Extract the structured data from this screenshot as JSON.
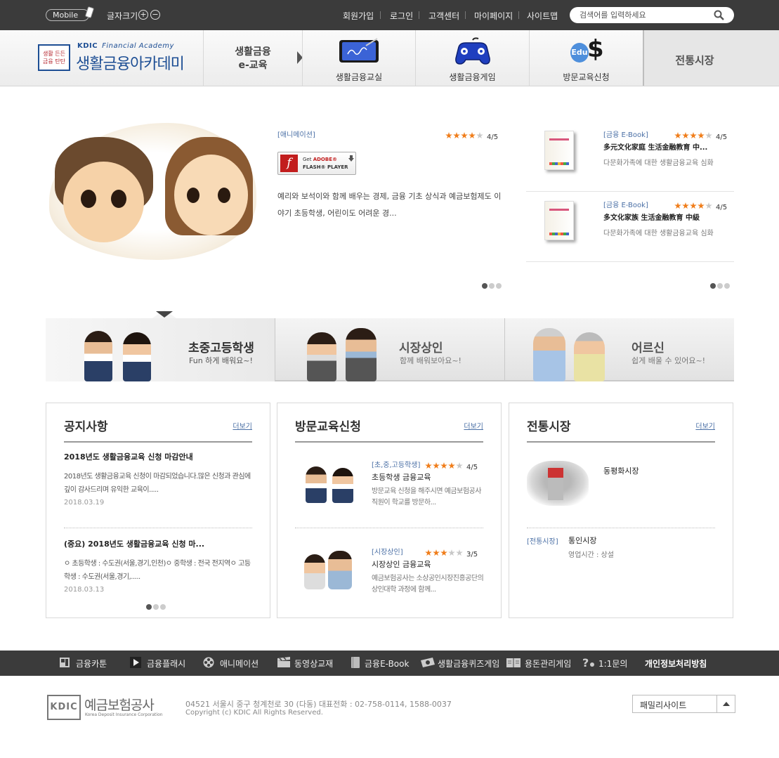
{
  "topbar": {
    "mobile_label": "Mobile",
    "font_size_label": "글자크기",
    "font_plus": "+",
    "font_minus": "−",
    "links": [
      "회원가입",
      "로그인",
      "고객센터",
      "마이페이지",
      "사이트맵"
    ],
    "search_placeholder": "검색어를 입력하세요"
  },
  "header": {
    "logo_seal_line1": "생활 든든",
    "logo_seal_line2": "금융 탄탄",
    "logo_kdic": "KDIC",
    "logo_academy": "Financial Academy",
    "logo_title": "생활금융아카데미",
    "nav_title_line1": "생활금융",
    "nav_title_line2": "e-교육",
    "nav_items": [
      "생활금융교실",
      "생활금융게임",
      "방문교육신청"
    ],
    "edu_icon_text": "Edu",
    "nav_last": "전통시장"
  },
  "featured": {
    "category": "[애니메이션]",
    "rating_value": 4,
    "rating_text": "4/5",
    "flash_line1_prefix": "Get ",
    "flash_line1_brand": "ADOBE®",
    "flash_line2": "FLASH® PLAYER",
    "description": "예리와 보석이와 함께 배우는 경제, 금융 기초 상식과 예금보험제도 이야기 초등학생, 어린이도 어려운 경..."
  },
  "ebooks": [
    {
      "category": "[금융 E-Book]",
      "rating_value": 4,
      "rating_text": "4/5",
      "title": "多元文化家庭 生活金融教育 中...",
      "desc": "다문화가족에 대한 생활금융교육 심화"
    },
    {
      "category": "[금융 E-Book]",
      "rating_value": 4,
      "rating_text": "4/5",
      "title": "多文化家族 生活金融教育 中級",
      "desc": "다문화가족에 대한 생활금융교육 심화"
    }
  ],
  "targets": [
    {
      "title": "초중고등학생",
      "sub": "Fun 하게 배워요~!"
    },
    {
      "title": "시장상인",
      "sub": "함께 배워보아요~!"
    },
    {
      "title": "어르신",
      "sub": "쉽게 배울 수 있어요~!"
    }
  ],
  "notice": {
    "title": "공지사항",
    "more": "더보기",
    "items": [
      {
        "title": "2018년도 생활금융교육 신청 마감안내",
        "body": "2018년도 생활금융교육 신청이 마감되었습니다.많은 신청과 관심에 깊이 감사드리며 유익한 교육이.....",
        "date": "2018.03.19"
      },
      {
        "title": "(중요) 2018년도 생활금융교육 신청 마...",
        "body": "ㅇ 초등학생 : 수도권(서울,경기,인천)ㅇ 중학생 : 전국 전지역ㅇ 고등학생 : 수도권(서울,경기,.....",
        "date": "2018.03.13"
      }
    ]
  },
  "visit": {
    "title": "방문교육신청",
    "more": "더보기",
    "items": [
      {
        "category": "[초,중,고등학생]",
        "rating_value": 4,
        "rating_text": "4/5",
        "title": "초등학생 금융교육",
        "body": "방문교육 신청을 해주시면 예금보험공사 직원이 학교를 방문하..."
      },
      {
        "category": "[시장상인]",
        "rating_value": 3,
        "rating_text": "3/5",
        "title": "시장상인 금융교육",
        "body": "예금보험공사는 소상공인시장진흥공단의 상인대학 과정에 함께..."
      }
    ]
  },
  "market": {
    "title": "전통시장",
    "more": "더보기",
    "featured_name": "동평화시장",
    "item_category": "[전통시장]",
    "item_name": "통인시장",
    "item_hours": "영업시간 : 상설"
  },
  "footnav": [
    "금융카툰",
    "금융플래시",
    "애니메이션",
    "동영상교재",
    "금융E-Book",
    "생활금융퀴즈게임",
    "용돈관리게임",
    "1:1문의",
    "개인정보처리방침"
  ],
  "footer": {
    "logo_text": "KDIC",
    "org_name": "예금보험공사",
    "org_eng": "Korea Deposit Insurance Corporation",
    "address": "04521   서울시 중구 청계천로 30 (다동)   대표전화 : 02-758-0114, 1588-0037",
    "copyright": "Copyright (c) KDIC All Rights Reserved.",
    "family_site": "패밀리사이트"
  },
  "colors": {
    "topbar_bg": "#3b3b3b",
    "brand_blue": "#1d4e94",
    "star_on": "#f07d1a",
    "link_blue": "#4a6fa5"
  }
}
